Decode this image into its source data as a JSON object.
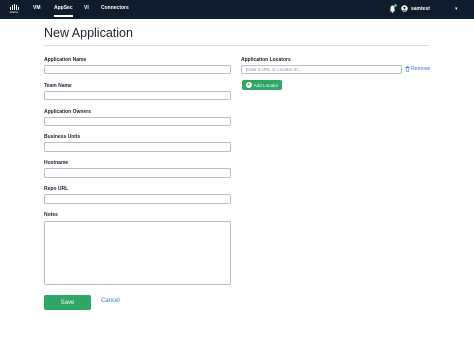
{
  "nav": {
    "logo_text": "cisco",
    "links": [
      "VM",
      "AppSec",
      "VI",
      "Connectors"
    ],
    "active": "AppSec",
    "user_name": "samtest",
    "bell_icon": "bell-icon",
    "user_icon": "user-icon"
  },
  "page": {
    "title": "New Application"
  },
  "form": {
    "fields": [
      {
        "label": "Application Name",
        "value": ""
      },
      {
        "label": "Team Name",
        "value": ""
      },
      {
        "label": "Application Owners",
        "value": ""
      },
      {
        "label": "Business Units",
        "value": ""
      },
      {
        "label": "Hostname",
        "value": ""
      },
      {
        "label": "Repo URL",
        "value": ""
      },
      {
        "label": "Notes",
        "value": ""
      }
    ],
    "locators": {
      "label": "Application Locators",
      "placeholder": "Enter a URL or Locator ID...",
      "remove_label": "Remove",
      "add_label": "Add Locator"
    },
    "save_label": "Save",
    "cancel_label": "Cancel"
  },
  "colors": {
    "nav_bg": "#0f1c2c",
    "primary_green": "#2ea664",
    "link_blue": "#2b7bd6",
    "notification_dot": "#2ecc71"
  }
}
